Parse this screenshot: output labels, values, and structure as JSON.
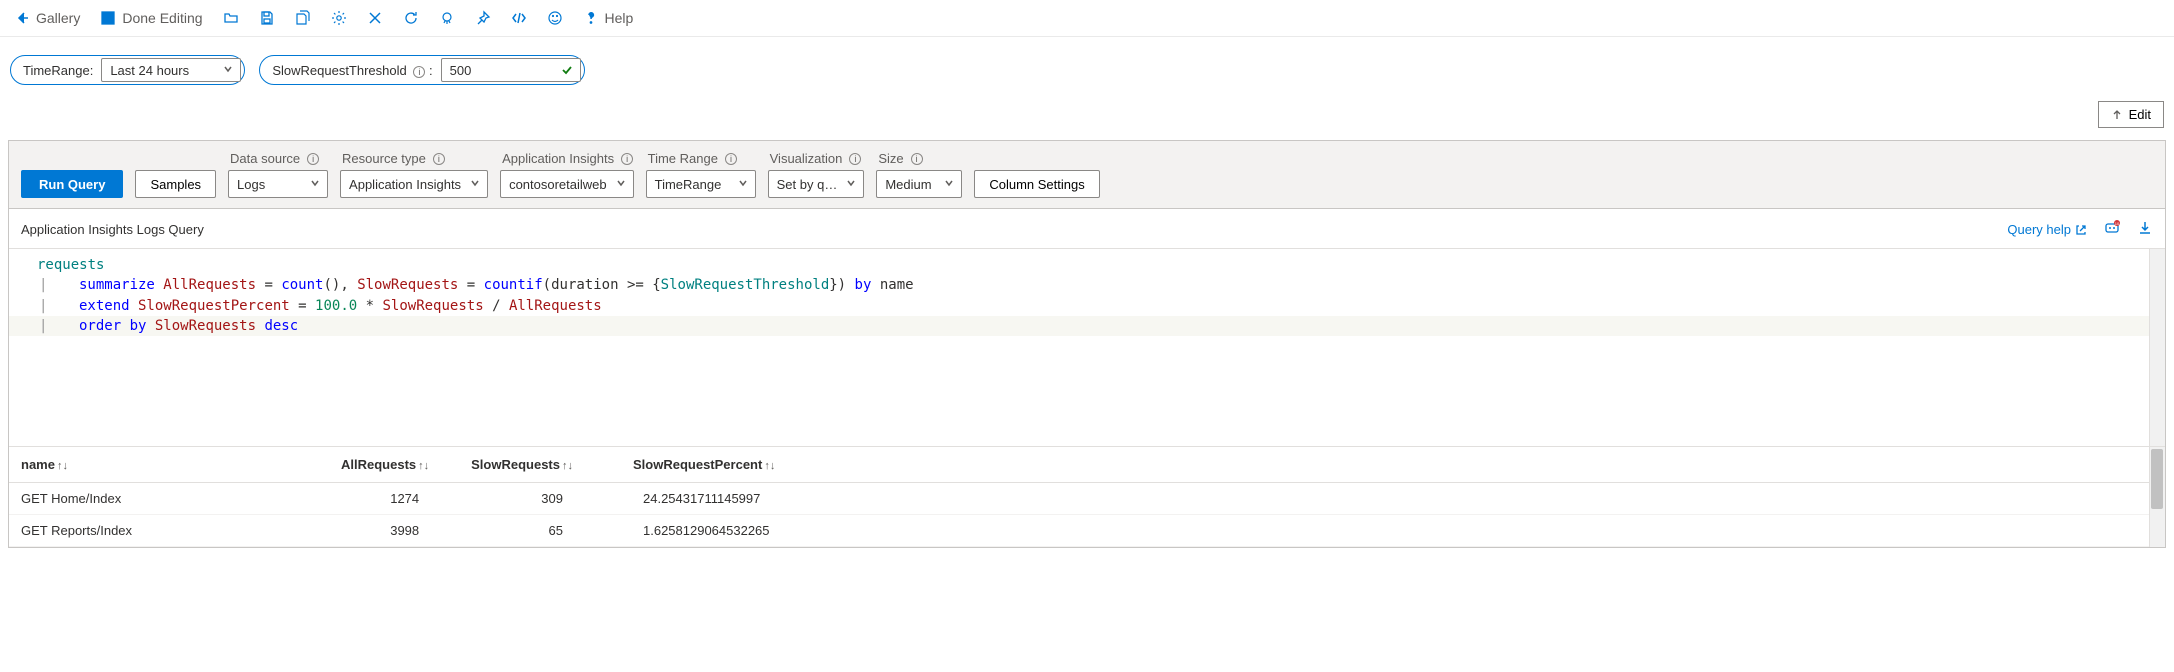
{
  "toolbar": {
    "gallery": "Gallery",
    "done_editing": "Done Editing",
    "help": "Help"
  },
  "params": {
    "time_range_label": "TimeRange:",
    "time_range_value": "Last 24 hours",
    "threshold_label": "SlowRequestThreshold",
    "threshold_suffix": ":",
    "threshold_value": "500"
  },
  "edit_btn": "Edit",
  "panel": {
    "run_query": "Run Query",
    "samples": "Samples",
    "data_source_label": "Data source",
    "data_source_value": "Logs",
    "resource_type_label": "Resource type",
    "resource_type_value": "Application Insights",
    "app_insights_label": "Application Insights",
    "app_insights_value": "contosoretailweb",
    "time_range_label": "Time Range",
    "time_range_value": "TimeRange",
    "visualization_label": "Visualization",
    "visualization_value": "Set by q…",
    "size_label": "Size",
    "size_value": "Medium",
    "column_settings": "Column Settings",
    "subtitle": "Application Insights Logs Query",
    "query_help": "Query help"
  },
  "query": {
    "line1_requests": "requests",
    "line2": {
      "summarize": "summarize",
      "allreq": "AllRequests",
      "eq1": " = ",
      "count": "count",
      "paren1": "(), ",
      "slowreq": "SlowRequests",
      "eq2": " = ",
      "countif": "countif",
      "open": "(duration >= {",
      "thresh": "SlowRequestThreshold",
      "close": "}) ",
      "by": "by",
      "name": " name"
    },
    "line3": {
      "extend": "extend",
      "srp": " SlowRequestPercent",
      "eq": " = ",
      "hundred": "100.0",
      "times": " * ",
      "sr": "SlowRequests",
      "div": " / ",
      "ar": "AllRequests"
    },
    "line4": {
      "orderby": "order by",
      "sr": " SlowRequests ",
      "desc": "desc"
    }
  },
  "table": {
    "headers": {
      "name": "name",
      "all": "AllRequests",
      "slow": "SlowRequests",
      "pct": "SlowRequestPercent"
    },
    "rows": [
      {
        "name": "GET Home/Index",
        "all": "1274",
        "slow": "309",
        "pct": "24.25431711145997"
      },
      {
        "name": "GET Reports/Index",
        "all": "3998",
        "slow": "65",
        "pct": "1.6258129064532265"
      }
    ]
  }
}
